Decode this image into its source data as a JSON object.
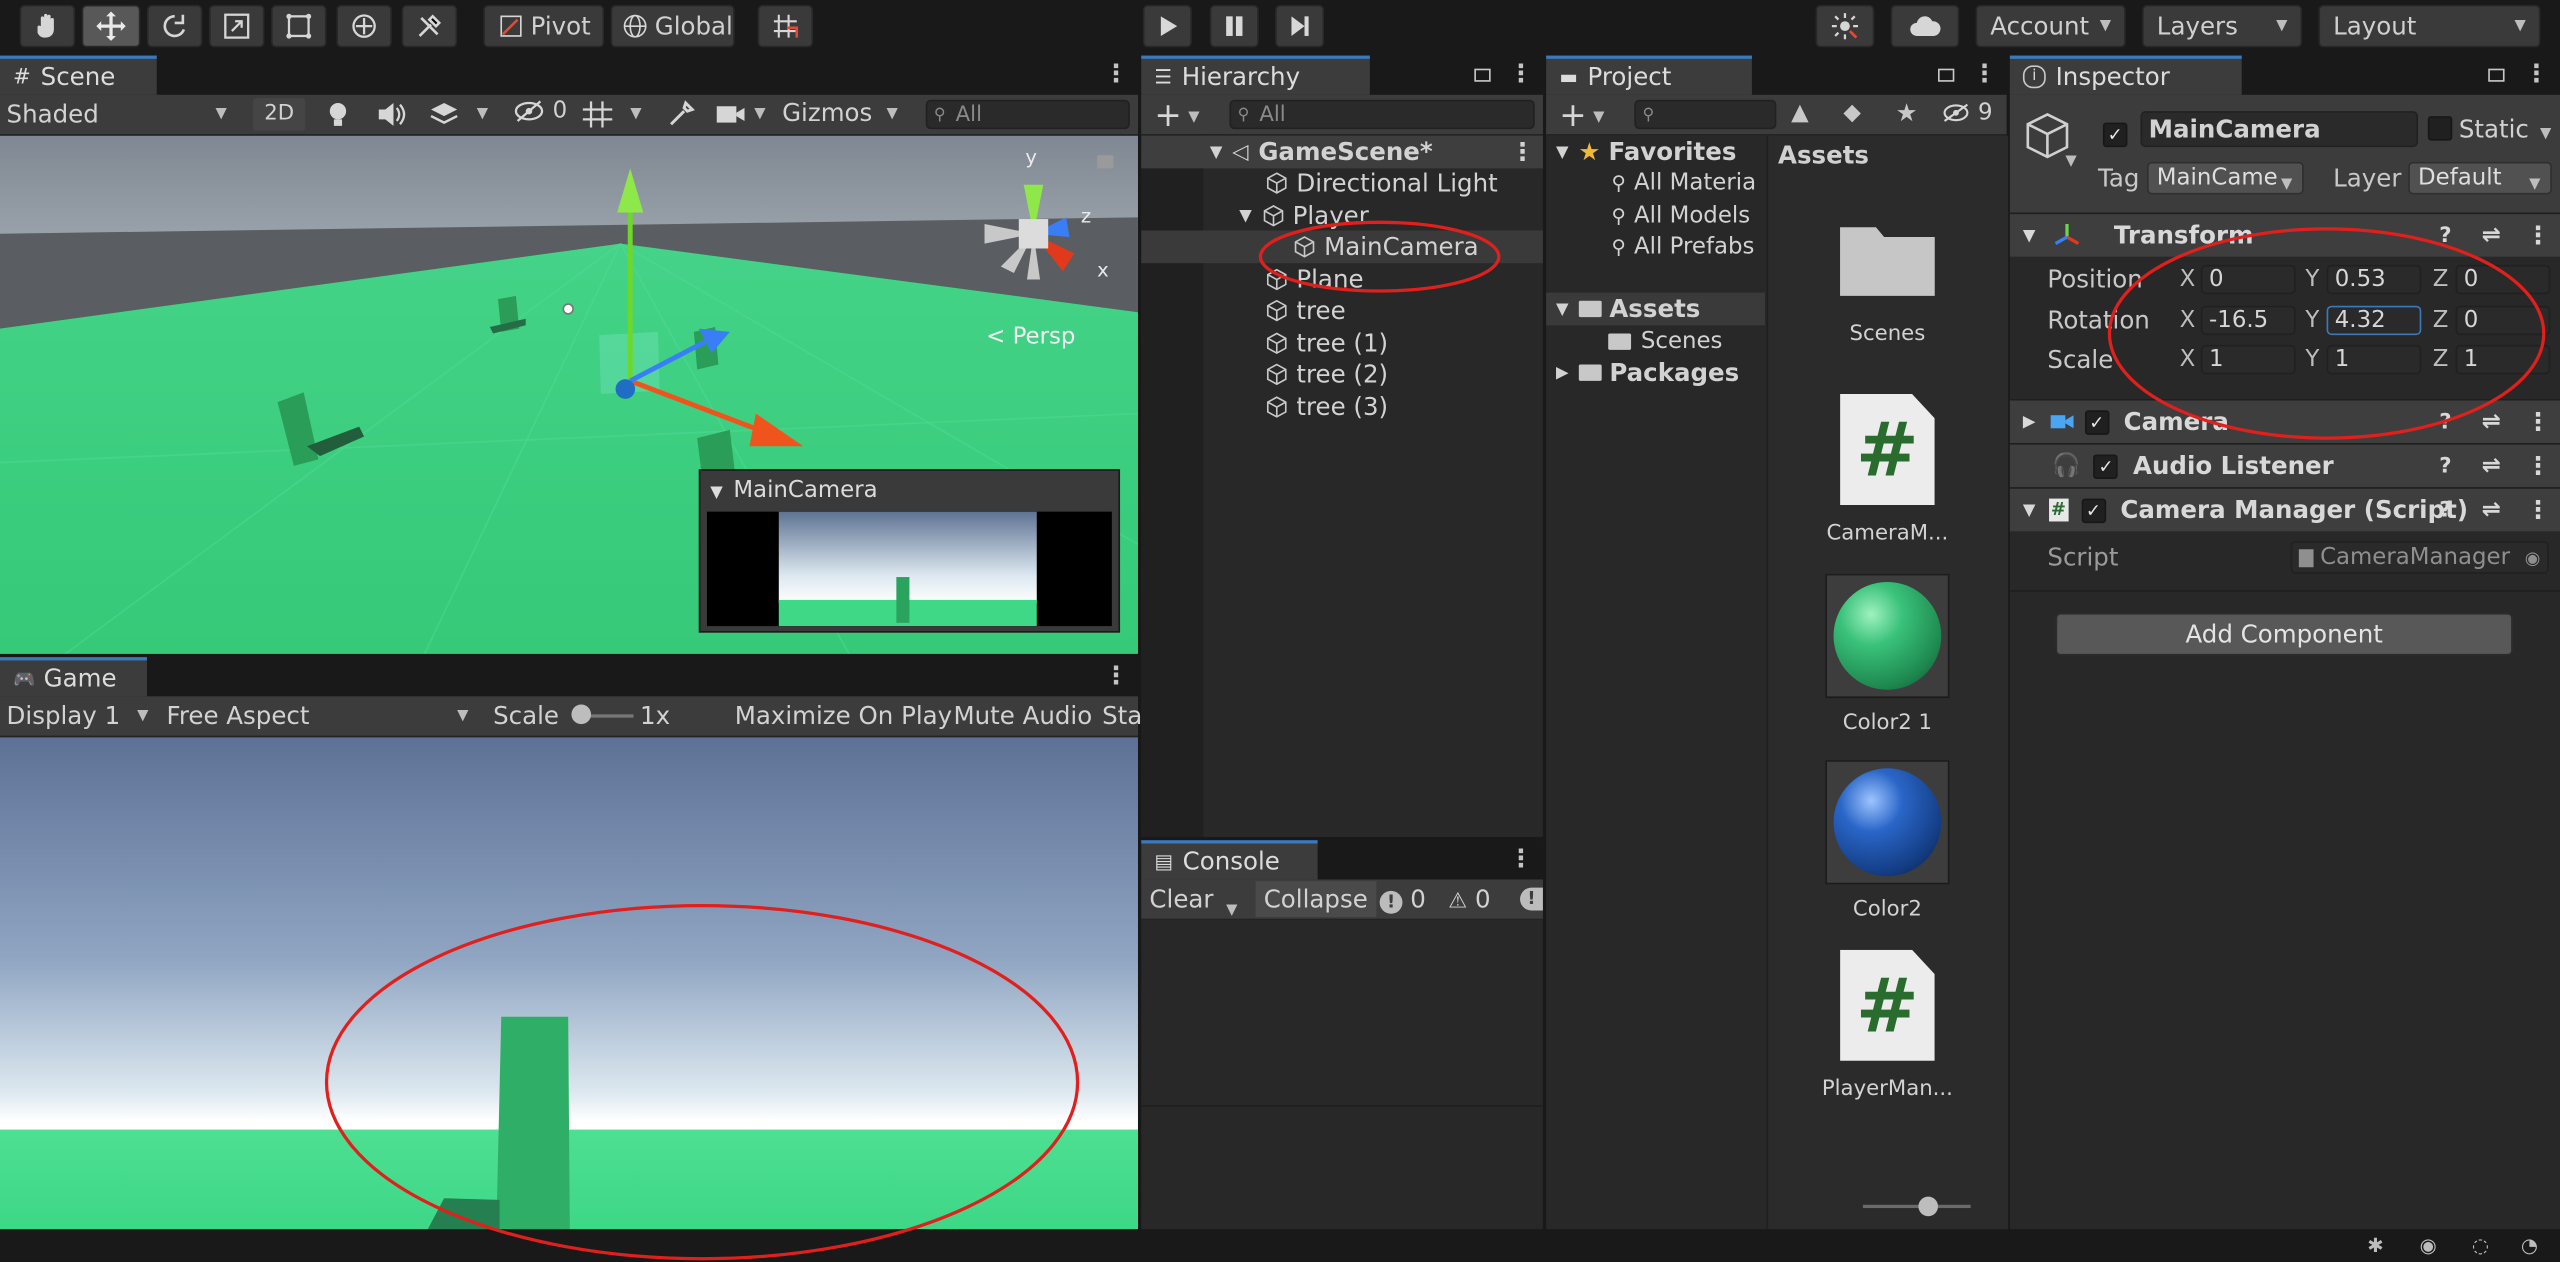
{
  "toolbar": {
    "pivot": "Pivot",
    "global": "Global",
    "account": "Account",
    "layers": "Layers",
    "layout": "Layout"
  },
  "scene": {
    "tab": "Scene",
    "shading": "Shaded",
    "mode_2d": "2D",
    "hidden_count": "0",
    "gizmos": "Gizmos",
    "search_placeholder": "All",
    "persp": "< Persp",
    "axis_x": "x",
    "axis_y": "y",
    "axis_z": "z",
    "camera_preview_title": "MainCamera"
  },
  "game": {
    "tab": "Game",
    "display": "Display 1",
    "aspect": "Free Aspect",
    "scale_label": "Scale",
    "scale_value": "1x",
    "maximize": "Maximize On Play",
    "mute": "Mute Audio",
    "stats": "Sta"
  },
  "hierarchy": {
    "tab": "Hierarchy",
    "search_placeholder": "All",
    "scene_name": "GameScene*",
    "items": [
      {
        "label": "Directional Light"
      },
      {
        "label": "Player"
      },
      {
        "label": "MainCamera"
      },
      {
        "label": "Plane"
      },
      {
        "label": "tree"
      },
      {
        "label": "tree (1)"
      },
      {
        "label": "tree (2)"
      },
      {
        "label": "tree (3)"
      }
    ]
  },
  "console": {
    "tab": "Console",
    "clear": "Clear",
    "collapse": "Collapse",
    "errors": "0",
    "warnings": "0"
  },
  "project": {
    "tab": "Project",
    "hidden_count": "9",
    "favorites": "Favorites",
    "fav_items": [
      "All Materia",
      "All Models",
      "All Prefabs"
    ],
    "assets_folder": "Assets",
    "scenes_folder": "Scenes",
    "packages_folder": "Packages",
    "assets_header": "Assets",
    "assets": [
      {
        "label": "Scenes"
      },
      {
        "label": "CameraM..."
      },
      {
        "label": "Color2 1"
      },
      {
        "label": "Color2"
      },
      {
        "label": "PlayerMan..."
      }
    ]
  },
  "inspector": {
    "tab": "Inspector",
    "object_name": "MainCamera",
    "static": "Static",
    "tag_label": "Tag",
    "tag_value": "MainCame",
    "layer_label": "Layer",
    "layer_value": "Default",
    "transform": {
      "title": "Transform",
      "position_label": "Position",
      "rotation_label": "Rotation",
      "scale_label": "Scale",
      "position": {
        "x": "0",
        "y": "0.53",
        "z": "0"
      },
      "rotation": {
        "x": "-16.5",
        "y": "4.32",
        "z": "0"
      },
      "scale": {
        "x": "1",
        "y": "1",
        "z": "1"
      }
    },
    "camera": "Camera",
    "audio_listener": "Audio Listener",
    "camera_manager": "Camera Manager (Script)",
    "script_label": "Script",
    "script_value": "CameraManager",
    "add_component": "Add Component"
  },
  "colors": {
    "accent": "#3a79bb",
    "annotation": "#e0201c",
    "ground": "#3fcf7f"
  }
}
